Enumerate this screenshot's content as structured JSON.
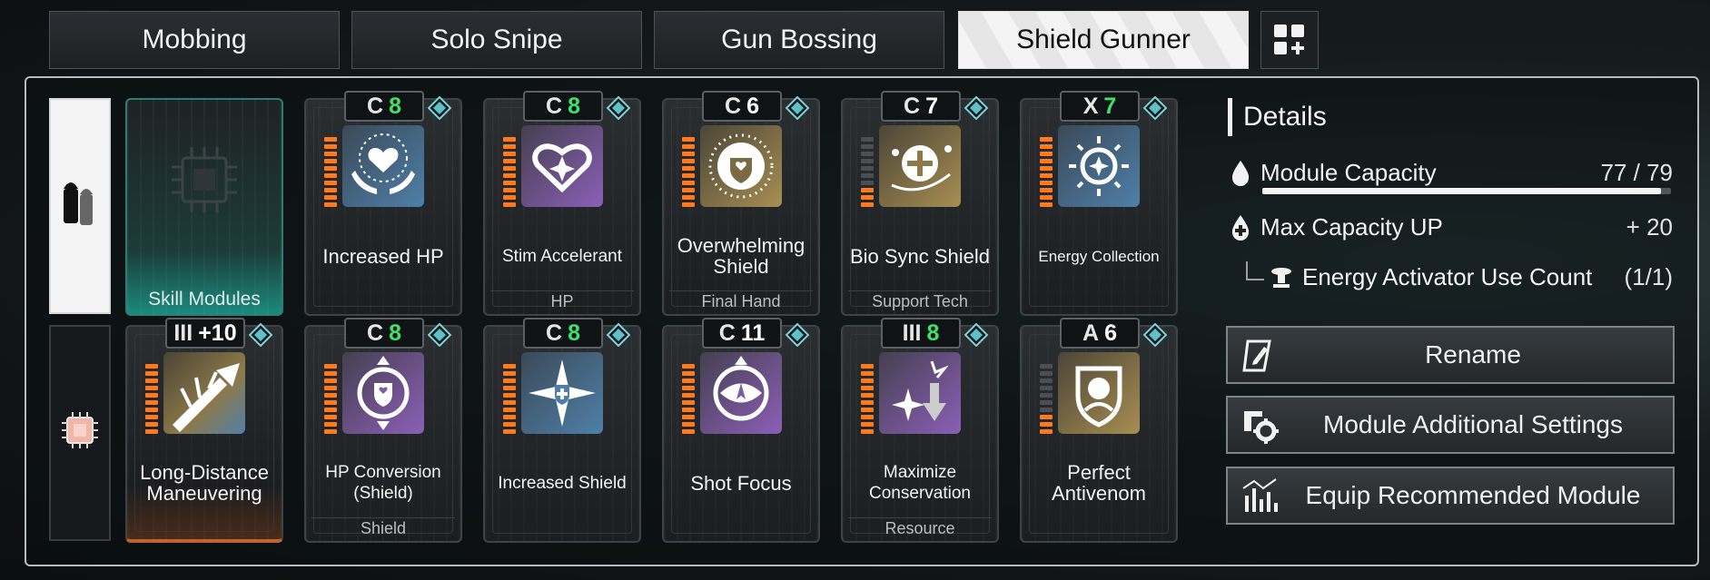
{
  "tabs": [
    {
      "label": "Mobbing",
      "active": false
    },
    {
      "label": "Solo Snipe",
      "active": false
    },
    {
      "label": "Gun Bossing",
      "active": false
    },
    {
      "label": "Shield Gunner",
      "active": true
    }
  ],
  "sidebar": {
    "items": [
      {
        "icon": "bullets-icon",
        "active": true
      },
      {
        "icon": "chip-icon",
        "active": false
      }
    ]
  },
  "skill_slot": {
    "label": "Skill Modules"
  },
  "modules": [
    {
      "name": "Increased HP",
      "category": "",
      "cost_symbol": "C",
      "cost": "8",
      "cost_color": "#3ee26b",
      "icon": "heart-hands-icon",
      "tint": "blue",
      "level": 10
    },
    {
      "name": "Stim Accelerant",
      "category": "HP",
      "cost_symbol": "C",
      "cost": "8",
      "cost_color": "#3ee26b",
      "icon": "sparkle-heart-icon",
      "tint": "purple",
      "level": 10
    },
    {
      "name": "Overwhelming Shield",
      "category": "Final Hand",
      "cost_symbol": "C",
      "cost": "6",
      "cost_color": "#ffffff",
      "icon": "spiked-shield-icon",
      "tint": "gold",
      "level": 10
    },
    {
      "name": "Bio Sync Shield",
      "category": "Support Tech",
      "cost_symbol": "C",
      "cost": "7",
      "cost_color": "#ffffff",
      "icon": "orbit-cross-icon",
      "tint": "gold",
      "level": 3
    },
    {
      "name": "Energy Collection",
      "category": "",
      "cost_symbol": "X",
      "cost": "7",
      "cost_color": "#3ee26b",
      "icon": "sun-star-icon",
      "tint": "blue",
      "level": 10
    },
    {
      "name": "Long-Distance Maneuvering",
      "category": "",
      "cost_symbol": "III",
      "cost": "+10",
      "cost_color": "#ffffff",
      "icon": "rifle-burst-icon",
      "tint": "goldblue",
      "level": 10
    },
    {
      "name": "HP Conversion (Shield)",
      "category": "Shield",
      "cost_symbol": "C",
      "cost": "8",
      "cost_color": "#3ee26b",
      "icon": "shield-swap-icon",
      "tint": "purple",
      "level": 10
    },
    {
      "name": "Increased Shield",
      "category": "",
      "cost_symbol": "C",
      "cost": "8",
      "cost_color": "#3ee26b",
      "icon": "compass-shield-icon",
      "tint": "blue",
      "level": 10
    },
    {
      "name": "Shot Focus",
      "category": "",
      "cost_symbol": "C",
      "cost": "11",
      "cost_color": "#ffffff",
      "icon": "focus-eye-icon",
      "tint": "purple",
      "level": 10
    },
    {
      "name": "Maximize Conservation",
      "category": "Resource",
      "cost_symbol": "III",
      "cost": "8",
      "cost_color": "#3ee26b",
      "icon": "sparkle-arrow-icon",
      "tint": "purple",
      "level": 10
    },
    {
      "name": "Perfect Antivenom",
      "category": "",
      "cost_symbol": "A",
      "cost": "6",
      "cost_color": "#ffffff",
      "icon": "toxin-shield-icon",
      "tint": "gold",
      "level": 3
    }
  ],
  "details": {
    "title": "Details",
    "capacity_label": "Module Capacity",
    "capacity_value": "77 / 79",
    "capacity_fraction": 0.975,
    "max_cap_label": "Max Capacity UP",
    "max_cap_value": "+ 20",
    "activator_label": "Energy Activator Use Count",
    "activator_value": "(1/1)"
  },
  "actions": {
    "rename": "Rename",
    "additional": "Module Additional Settings",
    "recommend": "Equip Recommended Module"
  }
}
